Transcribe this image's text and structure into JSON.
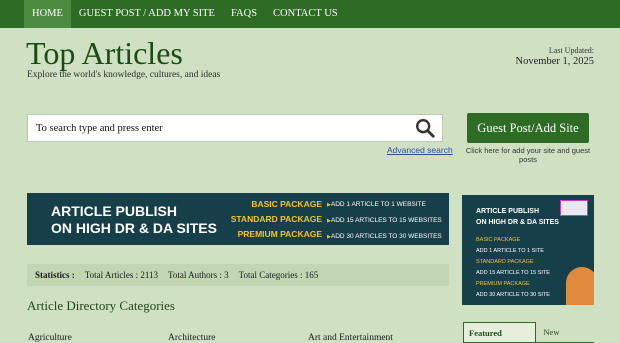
{
  "nav": {
    "items": [
      "HOME",
      "GUEST POST / ADD MY SITE",
      "FAQS",
      "CONTACT US"
    ]
  },
  "header": {
    "title": "Top Articles",
    "tagline": "Explore the world's knowledge, cultures, and ideas",
    "updated_label": "Last Updated:",
    "updated_date": "November 1, 2025"
  },
  "search": {
    "placeholder": "To search type and press enter",
    "advanced_link": "Advanced search"
  },
  "guest_post": {
    "button": "Guest Post/Add Site",
    "note": "Click here for add your site and guest posts"
  },
  "banner_main": {
    "headline": [
      "ARTICLE PUBLISH",
      "ON HIGH DR & DA SITES"
    ],
    "packages": [
      "BASIC PACKAGE",
      "STANDARD PACKAGE",
      "PREMIUM PACKAGE"
    ],
    "details": [
      "ADD 1 ARTICLE TO 1 WEBSITE",
      "ADD 15 ARTICLES TO 15 WEBSITES",
      "ADD 30 ARTICLES TO 30 WEBSITES"
    ]
  },
  "banner_side": {
    "headline": [
      "ARTICLE PUBLISH",
      "ON HIGH DR & DA SITES"
    ],
    "lines": [
      "BASIC PACKAGE",
      "ADD 1 ARTICLE TO 1 SITE",
      "STANDARD PACKAGE",
      "ADD 15 ARTICLE TO 15 SITE",
      "PREMIUM PACKAGE",
      "ADD 30 ARTICLE TO 30 SITE"
    ]
  },
  "stats": {
    "label": "Statistics :",
    "total_articles": "Total Articles : 2113",
    "total_authors": "Total Authors : 3",
    "total_categories": "Total Categories : 165"
  },
  "directory": {
    "title": "Article Directory Categories",
    "categories": [
      "Agriculture",
      "Architecture",
      "Art and Entertainment"
    ]
  },
  "side_tabs": [
    "Featured Articles",
    "New Articles"
  ],
  "colors": {
    "background": "#cfe0c3",
    "nav": "#2e6b25",
    "banner": "#173f4a",
    "accent_yellow": "#f2c230"
  }
}
